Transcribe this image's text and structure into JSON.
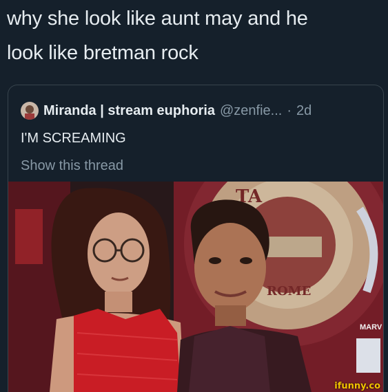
{
  "caption": {
    "line1": "why she look like aunt may and he",
    "line2": "look like bretman rock"
  },
  "quoted_tweet": {
    "avatar_icon": "user-avatar",
    "display_name": "Miranda | stream euphoria",
    "handle": "@zenfie...",
    "separator": "·",
    "time": "2d",
    "text": "I'M SCREAMING",
    "show_thread_label": "Show this thread"
  },
  "photo": {
    "icon": "photo-image",
    "sign_words": [
      "TA",
      "ROME",
      "MARV"
    ]
  },
  "watermark": "ifunny.co",
  "colors": {
    "background": "#15202b",
    "text": "#e6ecf0",
    "muted": "#8899a6",
    "border": "#38444d",
    "dress": "#d41f28",
    "watermark": "#f2c200"
  }
}
